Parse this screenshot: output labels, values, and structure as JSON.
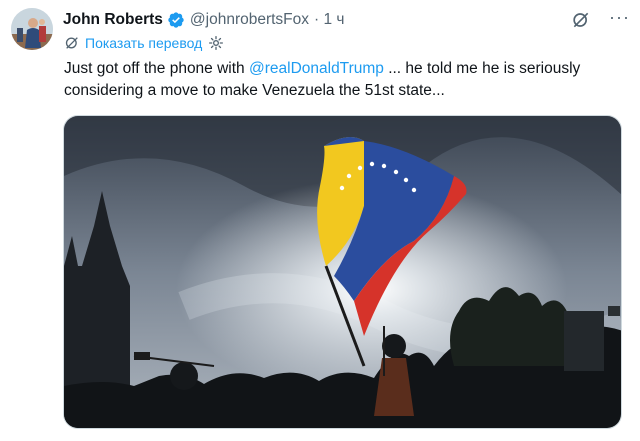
{
  "author": {
    "name": "John Roberts",
    "handle": "@johnrobertsFox",
    "time": "· 1 ч",
    "verified_color": "#1d9bf0"
  },
  "translate": {
    "label": "Показать перевод"
  },
  "tweet": {
    "text_before": "Just got off the phone with ",
    "mention": "@realDonaldTrump",
    "text_after": " ... he told me he is seriously considering a move to make Venezuela the 51st state..."
  },
  "icons": {
    "avatar": "avatar-photo",
    "verified": "verified-badge-icon",
    "grok": "grok-icon",
    "more": "more-icon",
    "translate": "translate-icon",
    "settings": "gear-icon"
  },
  "media": {
    "subject": "venezuelan-flag-photo"
  },
  "colors": {
    "accent": "#1d9bf0",
    "text": "#0f1419",
    "secondary": "#536471"
  }
}
